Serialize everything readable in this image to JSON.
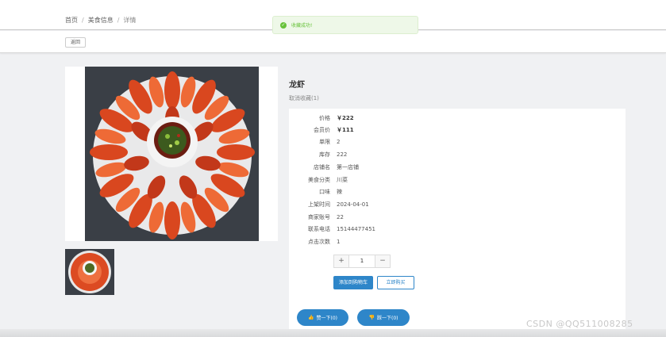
{
  "breadcrumb": {
    "home": "首页",
    "sep1": "/",
    "section": "美食信息",
    "sep2": "/",
    "current": "详情"
  },
  "toolbar": {
    "back_label": "返回"
  },
  "toast": {
    "message": "收藏成功!"
  },
  "product": {
    "title": "龙虾",
    "favorite_link": "取消收藏(1)",
    "fields": [
      {
        "label": "价格",
        "value": "￥222",
        "bold": true
      },
      {
        "label": "会员价",
        "value": "￥111",
        "bold": true
      },
      {
        "label": "单限",
        "value": "2",
        "bold": false
      },
      {
        "label": "库存",
        "value": "222",
        "bold": false
      },
      {
        "label": "店铺名",
        "value": "第一店铺",
        "bold": false
      },
      {
        "label": "美食分类",
        "value": "川菜",
        "bold": false
      },
      {
        "label": "口味",
        "value": "辣",
        "bold": false
      },
      {
        "label": "上架时间",
        "value": "2024-04-01",
        "bold": false
      },
      {
        "label": "商家账号",
        "value": "22",
        "bold": false
      },
      {
        "label": "联系电话",
        "value": "15144477451",
        "bold": false
      },
      {
        "label": "点击次数",
        "value": "1",
        "bold": false
      }
    ],
    "quantity": "1",
    "minus": "−",
    "plus": "+",
    "add_cart_label": "添加到购物车",
    "buy_now_label": "立即购买",
    "like_label": "赞一下(0)",
    "dislike_label": "踩一下(0)"
  },
  "watermark": "CSDN @QQ511008285",
  "colors": {
    "primary": "#2e86c9",
    "success": "#67c23a"
  }
}
